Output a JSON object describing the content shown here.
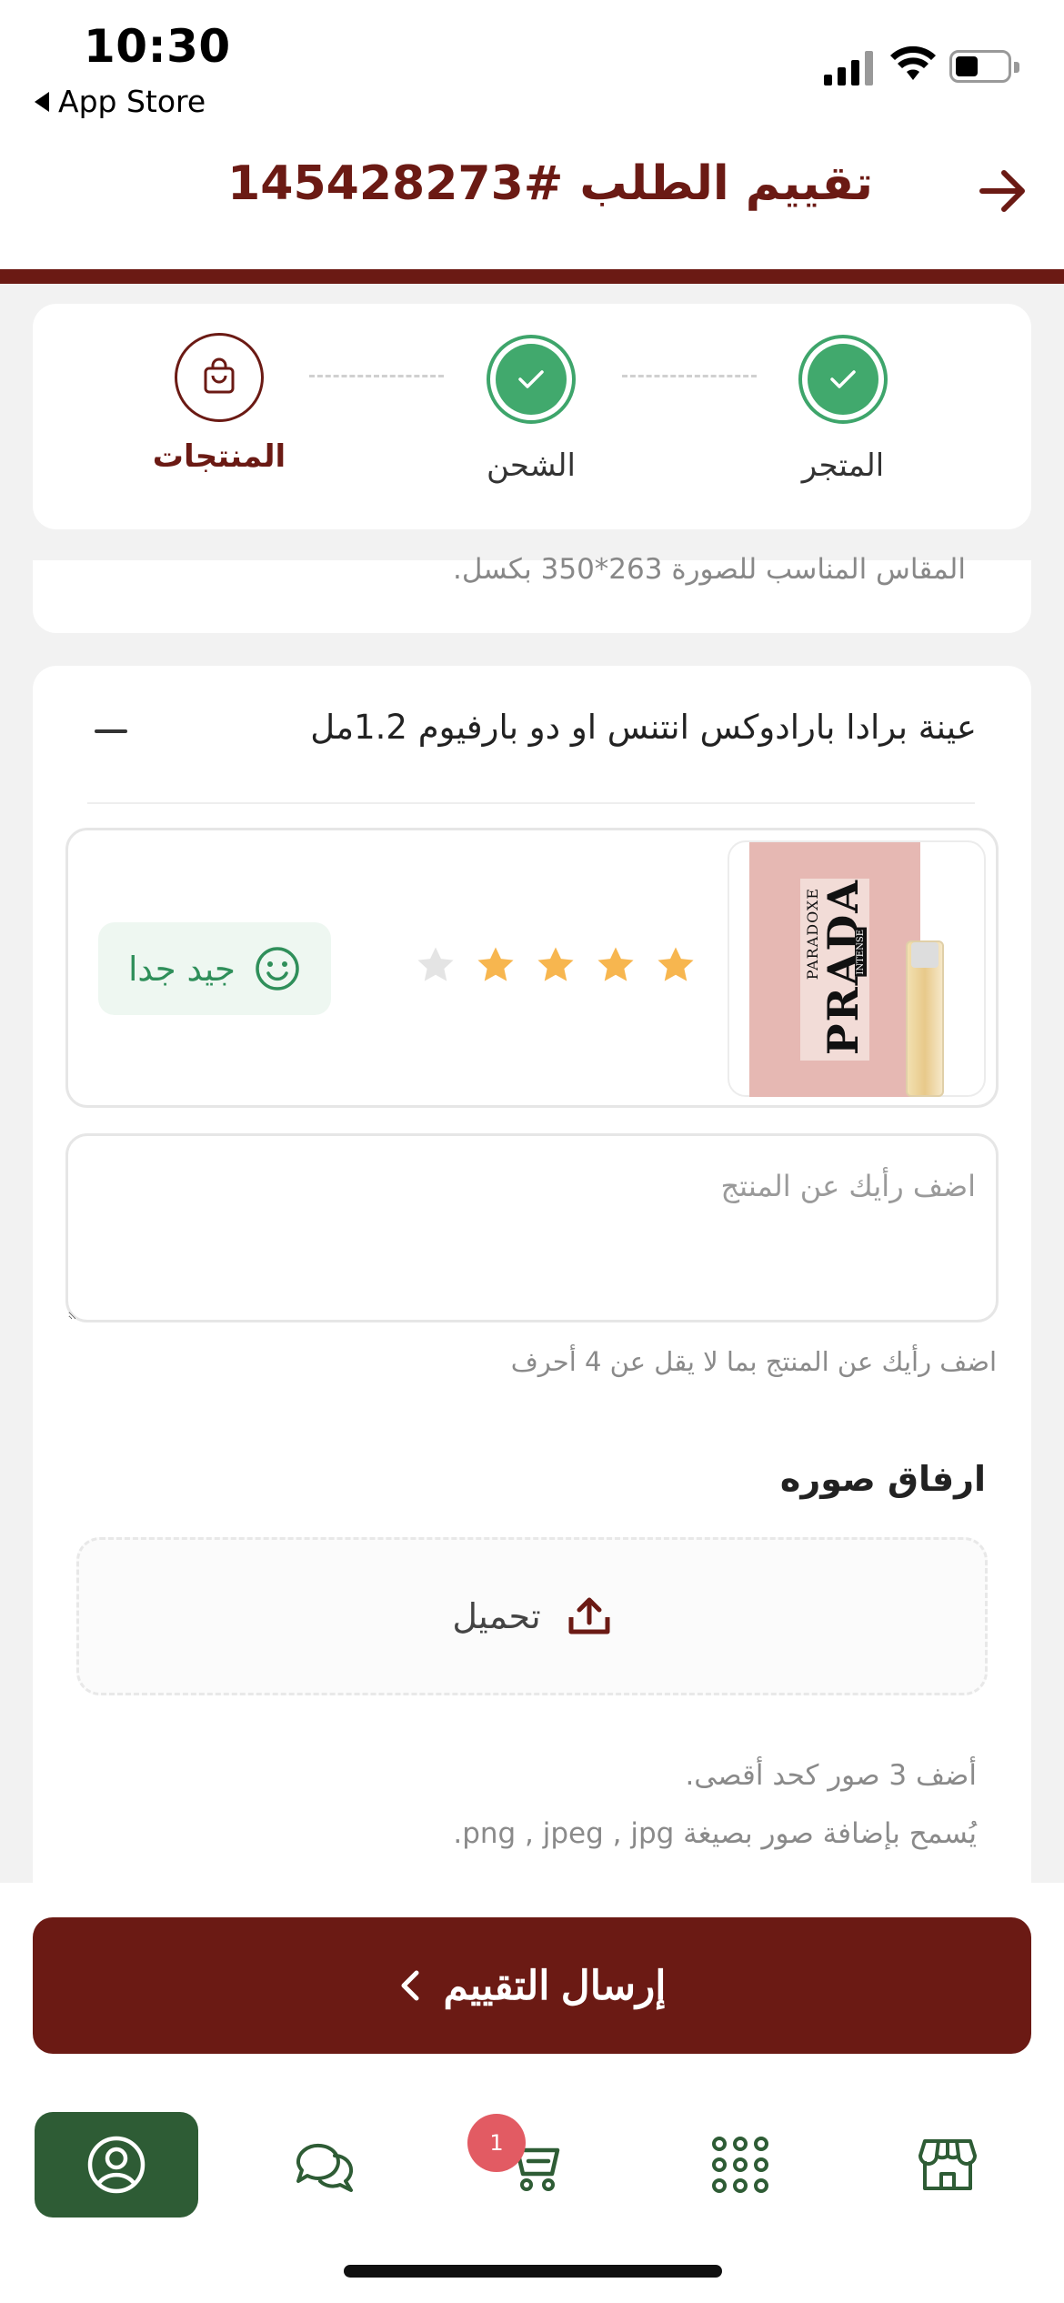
{
  "status_bar": {
    "time": "10:30",
    "back_app": "App Store"
  },
  "header": {
    "title": "تقييم الطلب #145428273",
    "back_icon": "arrow-right-icon"
  },
  "steps": [
    {
      "label": "المتجر",
      "state": "done"
    },
    {
      "label": "الشحن",
      "state": "done"
    },
    {
      "label": "المنتجات",
      "state": "current"
    }
  ],
  "info_note": "المقاس المناسب للصورة 263*350 بكسل.",
  "product": {
    "title": "عينة برادا بارادوكس انتنس او دو بارفيوم 1.2مل",
    "image_text": {
      "brand": "PRADA",
      "line": "PARADOXE",
      "sub": "INTENSE"
    },
    "rating": 4,
    "max_rating": 5,
    "mood_label": "جيد جدا",
    "review_placeholder": "اضف رأيك عن المنتج",
    "review_hint": "اضف رأيك عن المنتج بما لا يقل عن 4 أحرف"
  },
  "attach": {
    "title": "ارفاق صوره",
    "upload_label": "تحميل",
    "note_max": "أضف 3 صور كحد أقصى.",
    "note_formats": "يُسمح بإضافة صور بصيغة png , jpeg , jpg."
  },
  "submit_label": "إرسال التقييم",
  "tabbar": {
    "cart_badge": "1",
    "tabs": [
      "store-icon",
      "grid-icon",
      "cart-icon",
      "chat-icon",
      "profile-icon"
    ],
    "active": "profile-icon"
  },
  "colors": {
    "primary": "#6b1a14",
    "success": "#41a96d",
    "nav_active": "#2e5c35",
    "star": "#f7b64f"
  }
}
